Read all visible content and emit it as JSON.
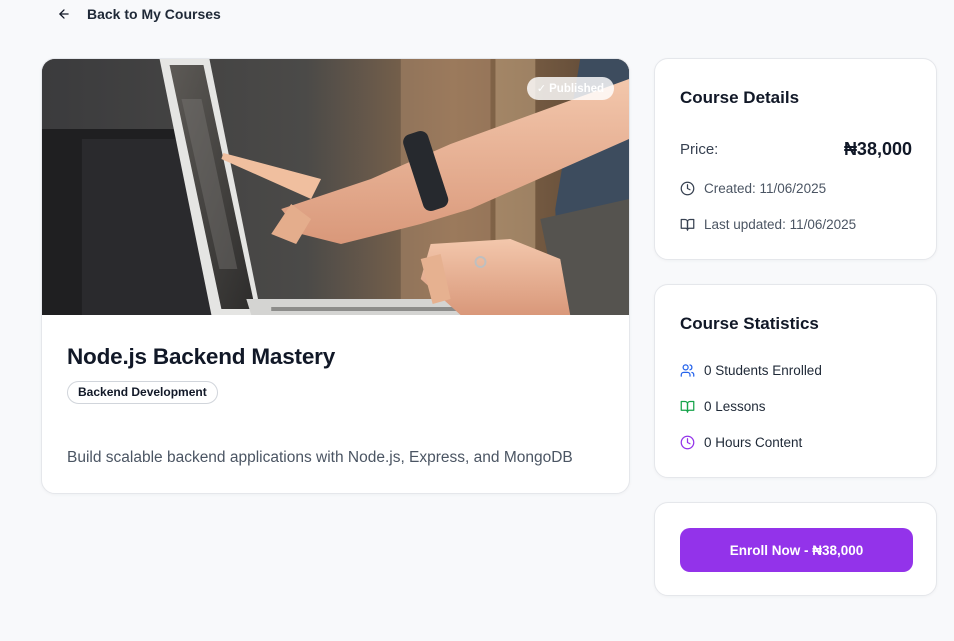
{
  "nav": {
    "back_label": "Back to My Courses"
  },
  "course": {
    "status_badge": "Published",
    "title": "Node.js Backend Mastery",
    "category": "Backend Development",
    "description": "Build scalable backend applications with Node.js, Express, and MongoDB"
  },
  "details": {
    "title": "Course Details",
    "price_label": "Price:",
    "price_value": "₦38,000",
    "created": "Created: 11/06/2025",
    "updated": "Last updated: 11/06/2025"
  },
  "stats": {
    "title": "Course Statistics",
    "students": "0 Students Enrolled",
    "lessons": "0 Lessons",
    "hours": "0 Hours Content"
  },
  "enroll": {
    "button_label": "Enroll Now - ₦38,000"
  },
  "colors": {
    "accent": "#9333ea",
    "students_icon": "#2563eb",
    "lessons_icon": "#16a34a",
    "hours_icon": "#9333ea"
  },
  "icons": {
    "back": "arrow-left-icon",
    "status": "check-icon",
    "created": "clock-icon",
    "updated": "book-open-icon",
    "students": "users-icon",
    "lessons": "book-open-icon",
    "hours": "clock-icon"
  }
}
